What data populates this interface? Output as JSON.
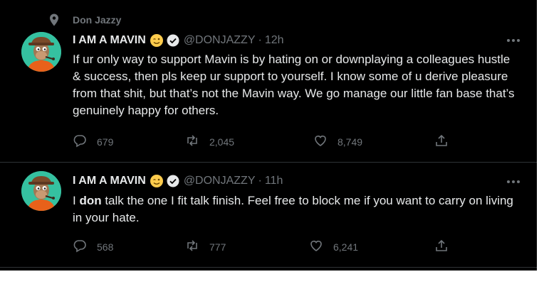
{
  "pinned_label": "Don Jazzy",
  "tweets": [
    {
      "name": "I AM A MAVIN",
      "handle": "@DONJAZZY",
      "separator": "·",
      "time": "12h",
      "text": "If ur only way to support Mavin is by hating on or downplaying a colleagues hustle & success, then pls keep ur support to yourself. I know some of u derive pleasure from that shit, but that’s not the Mavin way. We go manage our little fan base that’s genuinely happy for others.",
      "replies": "679",
      "retweets": "2,045",
      "likes": "8,749"
    },
    {
      "name": "I AM A MAVIN",
      "handle": "@DONJAZZY",
      "separator": "·",
      "time": "11h",
      "text_prefix": "I ",
      "text_bold": "don",
      "text_rest": " talk the one I fit talk finish. Feel free to block me if you want to carry on living in your hate.",
      "replies": "568",
      "retweets": "777",
      "likes": "6,241"
    }
  ],
  "icons": {
    "pin": "location-pin-icon",
    "more": "more-horizontal-icon",
    "verified": "verified-badge-icon",
    "emoji": "winking-face-icon",
    "reply": "reply-icon",
    "retweet": "retweet-icon",
    "like": "heart-icon",
    "share": "share-icon"
  },
  "colors": {
    "background": "#000000",
    "text": "#e7e9ea",
    "secondary": "#71767b",
    "divider": "#2f3336",
    "avatar_bg": "#35c1a0"
  }
}
